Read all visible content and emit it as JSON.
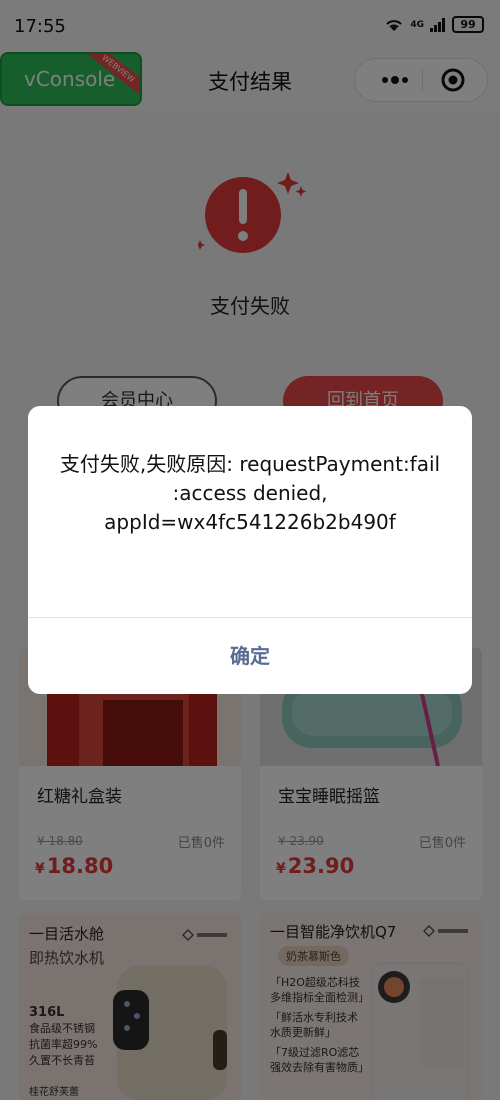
{
  "status_bar": {
    "time": "17:55",
    "network": "4G",
    "battery": "99"
  },
  "vconsole": {
    "label": "vConsole",
    "ribbon": "WEBVIEW"
  },
  "nav": {
    "title": "支付结果"
  },
  "result": {
    "status_text": "支付失败"
  },
  "actions": {
    "member_center": "会员中心",
    "back_home": "回到首页"
  },
  "products": [
    {
      "name": "红糖礼盒装",
      "original_price": "¥ 18.80",
      "sold": "已售0件",
      "currency": "¥",
      "price": "18.80"
    },
    {
      "name": "宝宝睡眠摇篮",
      "original_price": "¥ 23.90",
      "sold": "已售0件",
      "currency": "¥",
      "price": "23.90"
    }
  ],
  "promos": [
    {
      "title": "一目活水舱",
      "subtitle": "即热饮水机",
      "lines": [
        "316L",
        "食品级不锈钢",
        "抗菌率超99%",
        "久置不长青苔"
      ],
      "footer": "桂花舒芙蕾"
    },
    {
      "title": "一目智能净饮机Q7",
      "subtitle": "奶茶慕斯色",
      "lines": [
        "「H2O超级芯科技",
        "多维指标全面检测」",
        "「鲜活水专利技术",
        "水质更新鲜」",
        "「7级过滤RO滤芯",
        "强效去除有害物质」"
      ],
      "footer": ""
    }
  ],
  "modal": {
    "message": "支付失败,失败原因: requestPayment:fail :access denied, appId=wx4fc541226b2b490f",
    "confirm_label": "确定"
  },
  "colors": {
    "accent_red": "#e2383a",
    "confirm_blue": "#576b95",
    "vconsole_green": "#2dbf5b"
  }
}
